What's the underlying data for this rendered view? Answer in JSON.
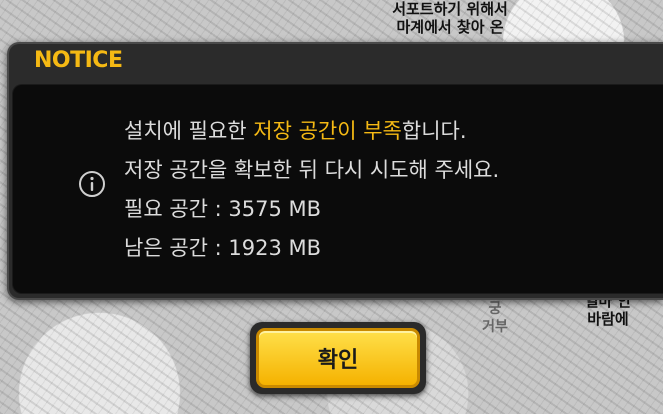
{
  "background": {
    "top_text": "서포트하기 위해서\n마계에서 찾아 온",
    "right_text": "얼마 안\n바람에",
    "mid_text": "궁\n거부"
  },
  "dialog": {
    "title": "NOTICE",
    "icon": "info-circle-icon",
    "line1_prefix": "설치에 필요한 ",
    "line1_highlight": "저장 공간이 부족",
    "line1_suffix": "합니다.",
    "line2": "저장 공간을 확보한 뒤 다시 시도해 주세요.",
    "line3": "필요 공간 : 3575 MB",
    "line4": "남은 공간 : 1923 MB",
    "confirm_label": "확인"
  },
  "colors": {
    "accent": "#f5b914",
    "text": "#dcdcdc",
    "panel": "#2b2b2b",
    "content": "#0b0b0b"
  }
}
